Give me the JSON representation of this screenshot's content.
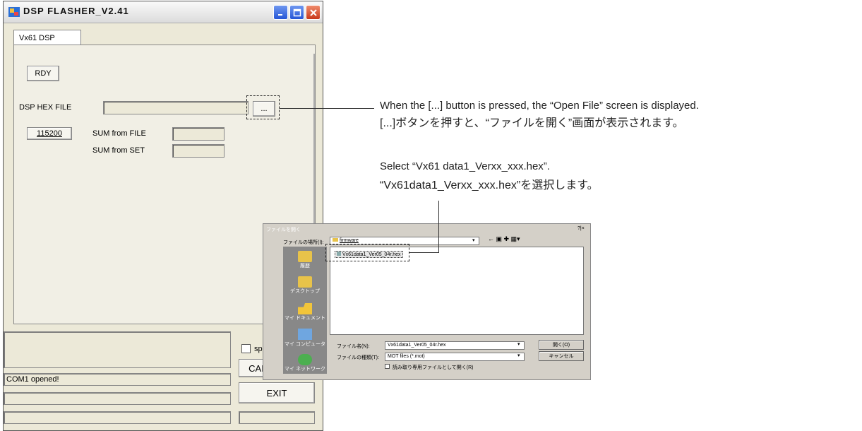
{
  "window": {
    "title": "DSP FLASHER_V2.41",
    "tab_label": "Vx61 DSP",
    "rdy_button": "RDY",
    "hex_file_label": "DSP HEX FILE",
    "browse_button": "...",
    "baud_button": "115200",
    "sum_file_label": "SUM from FILE",
    "sum_set_label": "SUM from SET",
    "checkbox_label": "spe",
    "cal_button": "CAI",
    "status_text": "COM1 opened!",
    "exit_button": "EXIT"
  },
  "dialog": {
    "title": "ファイルを開く",
    "help_close": "?|×",
    "location_label": "ファイルの場所(I):",
    "location_value": "firmware",
    "file_item": "Vx61data1_Ver05_04r.hex",
    "sidebar": [
      "履歴",
      "デスクトップ",
      "マイ ドキュメント",
      "マイ コンピュータ",
      "マイ ネットワーク"
    ],
    "filename_label": "ファイル名(N):",
    "filename_value": "Vx61data1_Ver05_04r.hex",
    "filetype_label": "ファイルの種類(T):",
    "filetype_value": "MOT files (*.mot)",
    "readonly_label": "読み取り専用ファイルとして開く(R)",
    "open_button": "開く(O)",
    "cancel_button": "キャンセル"
  },
  "annotations": {
    "a1_en": "When the [...] button is pressed, the “Open File” screen is displayed.",
    "a1_ja": "[...]ボタンを押すと、“ファイルを開く”画面が表示されます。",
    "a2_en": "Select “Vx61 data1_Verxx_xxx.hex”.",
    "a2_ja": "“Vx61data1_Verxx_xxx.hex”を選択します。"
  }
}
